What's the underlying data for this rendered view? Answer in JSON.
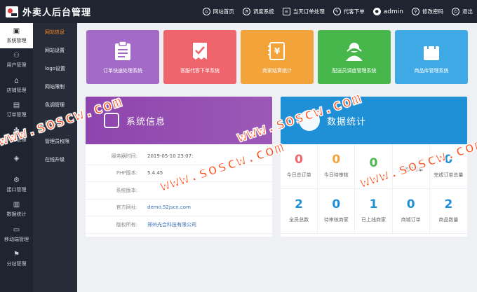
{
  "app": {
    "title": "外卖人后台管理"
  },
  "topnav": [
    {
      "label": "网站首页",
      "icon": "home-icon"
    },
    {
      "label": "调度系统",
      "icon": "dispatch-icon"
    },
    {
      "label": "当天订单处理",
      "icon": "order-icon"
    },
    {
      "label": "代客下单",
      "icon": "proxy-order-icon"
    },
    {
      "label": "admin",
      "icon": "user-icon"
    },
    {
      "label": "修改密码",
      "icon": "password-icon"
    },
    {
      "label": "退出",
      "icon": "logout-icon"
    }
  ],
  "sidebar": {
    "items": [
      {
        "label": "系统管理",
        "icon": "settings-icon",
        "active": true
      },
      {
        "label": "用户管理",
        "icon": "users-icon"
      },
      {
        "label": "店铺管理",
        "icon": "store-icon"
      },
      {
        "label": "订单管理",
        "icon": "orders-icon"
      },
      {
        "label": "内容管理",
        "icon": "content-icon"
      },
      {
        "label": "",
        "icon": "misc-icon"
      },
      {
        "label": "接口管理",
        "icon": "api-icon"
      },
      {
        "label": "数据统计",
        "icon": "stats-icon"
      },
      {
        "label": "移动端管理",
        "icon": "mobile-icon"
      },
      {
        "label": "分站管理",
        "icon": "substation-icon"
      }
    ]
  },
  "submenu": {
    "items": [
      {
        "label": "网站信息",
        "active": true
      },
      {
        "label": "网站设置"
      },
      {
        "label": "logo设置"
      },
      {
        "label": "网站限制"
      },
      {
        "label": "色调管理"
      },
      {
        "label": "网站升"
      },
      {
        "label": "管理员权限"
      },
      {
        "label": "在线升级"
      }
    ]
  },
  "tiles": [
    {
      "label": "订单快速处理系统",
      "color": "#a36bc7",
      "icon": "clipboard-icon"
    },
    {
      "label": "客服代客下单系统",
      "color": "#f0646b",
      "icon": "checklist-icon"
    },
    {
      "label": "商家结算统计",
      "color": "#f2a43a",
      "icon": "invoice-icon"
    },
    {
      "label": "配送员调度管理系统",
      "color": "#47b74b",
      "icon": "courier-icon"
    },
    {
      "label": "商品库管理系统",
      "color": "#3ea9e5",
      "icon": "shopping-bag-icon"
    }
  ],
  "system_info": {
    "title": "系统信息",
    "rows": [
      {
        "key": "服务器时间:",
        "value": "2019-05-10 23:07:"
      },
      {
        "key": "PHP版本:",
        "value": "5.4.45"
      },
      {
        "key": "系统版本:",
        "value": ""
      },
      {
        "key": "官方网址:",
        "value": "demo.52jscn.com"
      },
      {
        "key": "版权所有:",
        "value": "郑州光合科技有限公司"
      }
    ]
  },
  "data_stats": {
    "title": "数据统计",
    "items": [
      {
        "value": "0",
        "label": "今日总订单",
        "color": "#f0646b"
      },
      {
        "value": "0",
        "label": "今日待审核",
        "color": "#f2a43a"
      },
      {
        "value": "0",
        "label": "",
        "color": "#47b74b"
      },
      {
        "value": "",
        "label": "月完成订单",
        "color": "#1f8fd6"
      },
      {
        "value": "0",
        "label": "完成订单总量",
        "color": "#1f8fd6"
      },
      {
        "value": "2",
        "label": "全员总数",
        "color": "#1f8fd6"
      },
      {
        "value": "0",
        "label": "待审核商家",
        "color": "#1f8fd6"
      },
      {
        "value": "1",
        "label": "已上线商家",
        "color": "#1f8fd6"
      },
      {
        "value": "0",
        "label": "商城订单",
        "color": "#1f8fd6"
      },
      {
        "value": "2",
        "label": "商品数量",
        "color": "#1f8fd6"
      }
    ]
  },
  "watermark": {
    "text_1": "www.soscw.com",
    "text_2": "www.soscw.com",
    "text_3": "www.soscw.com",
    "text_4": "www.soscw.com"
  }
}
